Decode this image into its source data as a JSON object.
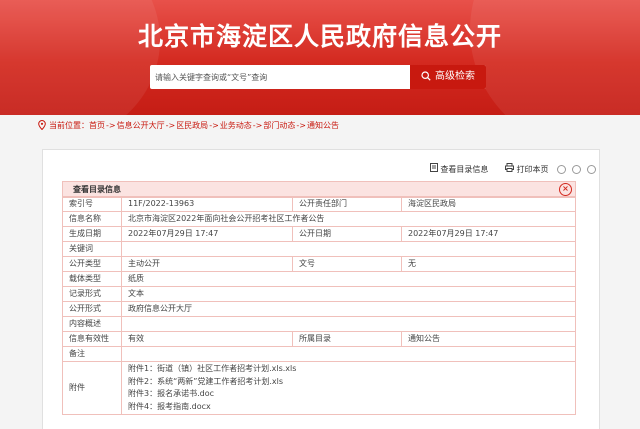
{
  "header": {
    "title": "北京市海淀区人民政府信息公开"
  },
  "search": {
    "placeholder": "请输入关键字查询或“文号”查询",
    "button_label": "高级检索"
  },
  "breadcrumb": {
    "prefix": "当前位置：",
    "items": [
      "首页",
      "信息公开大厅",
      "区民政局",
      "业务动态",
      "部门动态",
      "通知公告"
    ],
    "separator": "->"
  },
  "toolbar": {
    "view_catalog": "查看目录信息",
    "print": "打印本页"
  },
  "info": {
    "title": "查看目录信息",
    "rows": [
      {
        "k1": "索引号",
        "v1": "11F/2022-13963",
        "k2": "公开责任部门",
        "v2": "海淀区民政局"
      },
      {
        "k1": "信息名称",
        "v1": "北京市海淀区2022年面向社会公开招考社区工作者公告"
      },
      {
        "k1": "生成日期",
        "v1": "2022年07月29日 17:47",
        "k2": "公开日期",
        "v2": "2022年07月29日 17:47"
      },
      {
        "k1": "关键词",
        "v1": ""
      },
      {
        "k1": "公开类型",
        "v1": "主动公开",
        "k2": "文号",
        "v2": "无"
      },
      {
        "k1": "载体类型",
        "v1": "纸质"
      },
      {
        "k1": "记录形式",
        "v1": "文本"
      },
      {
        "k1": "公开形式",
        "v1": "政府信息公开大厅"
      },
      {
        "k1": "内容概述",
        "v1": ""
      },
      {
        "k1": "信息有效性",
        "v1": "有效",
        "k2": "所属目录",
        "v2": "通知公告"
      },
      {
        "k1": "备注",
        "v1": ""
      }
    ],
    "attachment_label": "附件",
    "attachments": [
      "附件1：街道（镇）社区工作者招考计划.xls.xls",
      "附件2：系统“两新”党建工作者招考计划.xls",
      "附件3：报名承诺书.doc",
      "附件4：报考指南.docx"
    ]
  },
  "colors": {
    "brand": "#c8190f",
    "banner_light": "#e8514a"
  }
}
